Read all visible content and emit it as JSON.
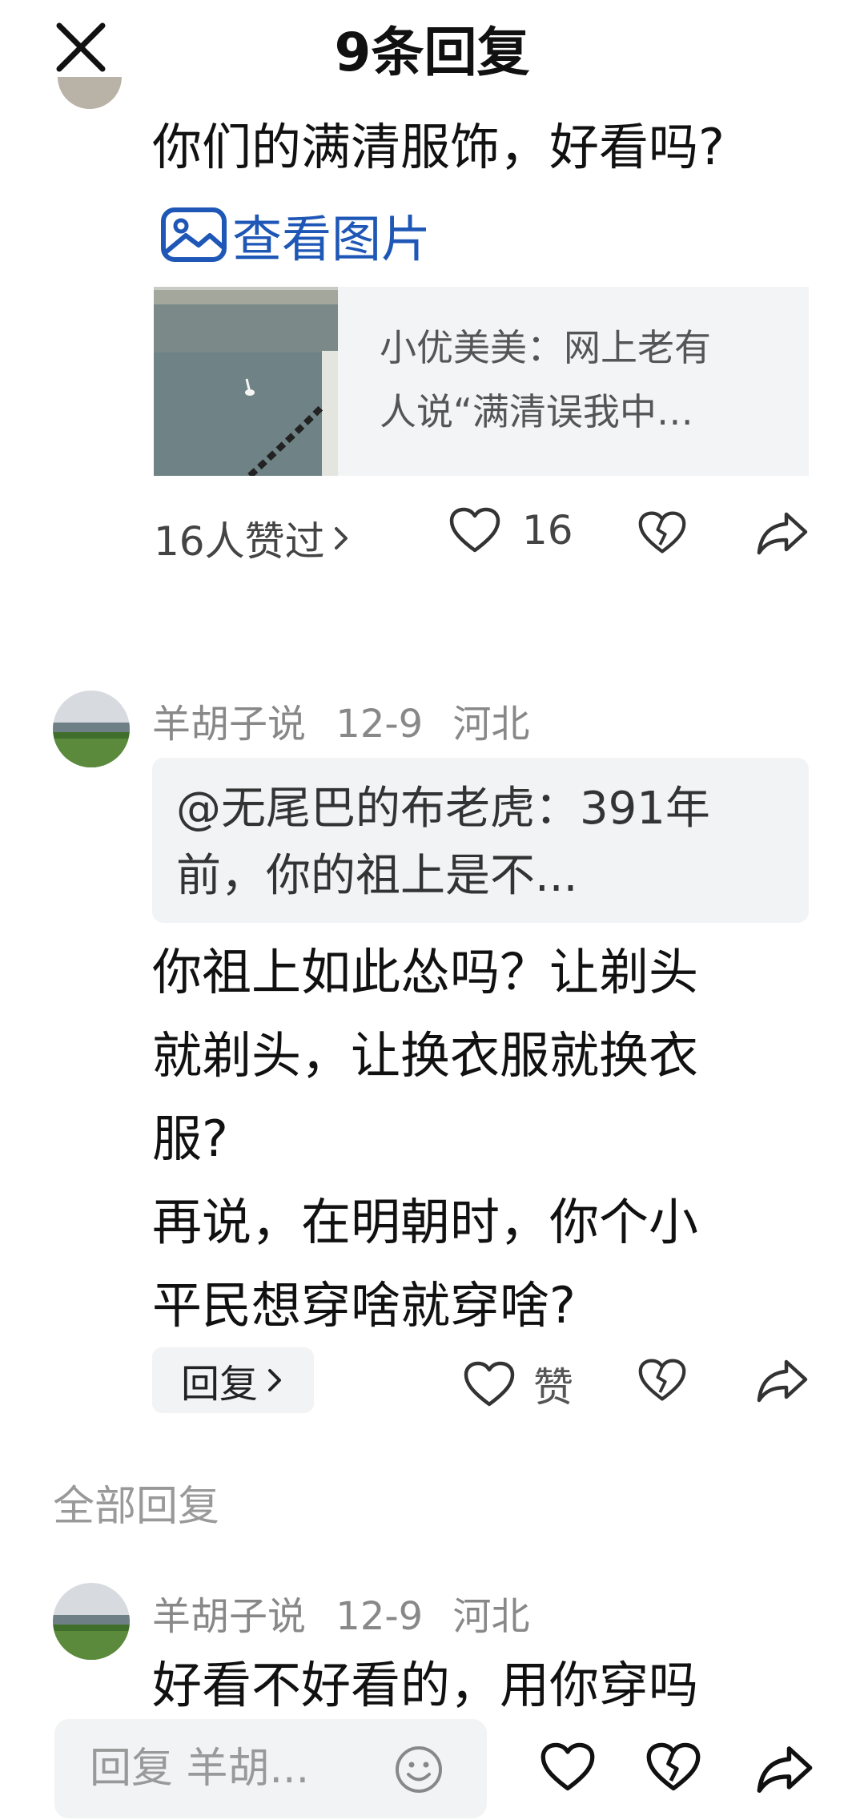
{
  "header": {
    "title": "9条回复",
    "close_icon": "close-icon"
  },
  "top_comment": {
    "text": "你们的满清服饰，好看吗?",
    "view_image_label": "查看图片",
    "view_image_icon": "image-icon",
    "linked_post": {
      "text_line1": "小优美美：网上老有",
      "text_line2": "人说“满清误我中…"
    },
    "likes_summary": "16人赞过",
    "like_count": "16",
    "icons": [
      "heart-icon",
      "broken-heart-icon",
      "share-icon"
    ]
  },
  "reply": {
    "author": "羊胡子说",
    "date": "12-9",
    "location": "河北",
    "quote_line1": "@无尾巴的布老虎：391年",
    "quote_line2": "前，你的祖上是不...",
    "lines": [
      "你祖上如此怂吗？让剃头",
      "就剃头，让换衣服就换衣",
      "服?",
      "再说，在明朝时，你个小",
      "平民想穿啥就穿啥?"
    ],
    "reply_button": "回复",
    "like_label": "赞"
  },
  "all_replies": {
    "title": "全部回复",
    "first": {
      "author": "羊胡子说",
      "date": "12-9",
      "location": "河北",
      "text": "好看不好看的，用你穿吗"
    }
  },
  "bottom_bar": {
    "input_placeholder": "回复 羊胡...",
    "emoji_icon": "emoji-icon"
  },
  "colors": {
    "link_blue": "#1e57b6",
    "meta_gray": "#888888",
    "card_bg": "#f3f4f6"
  }
}
